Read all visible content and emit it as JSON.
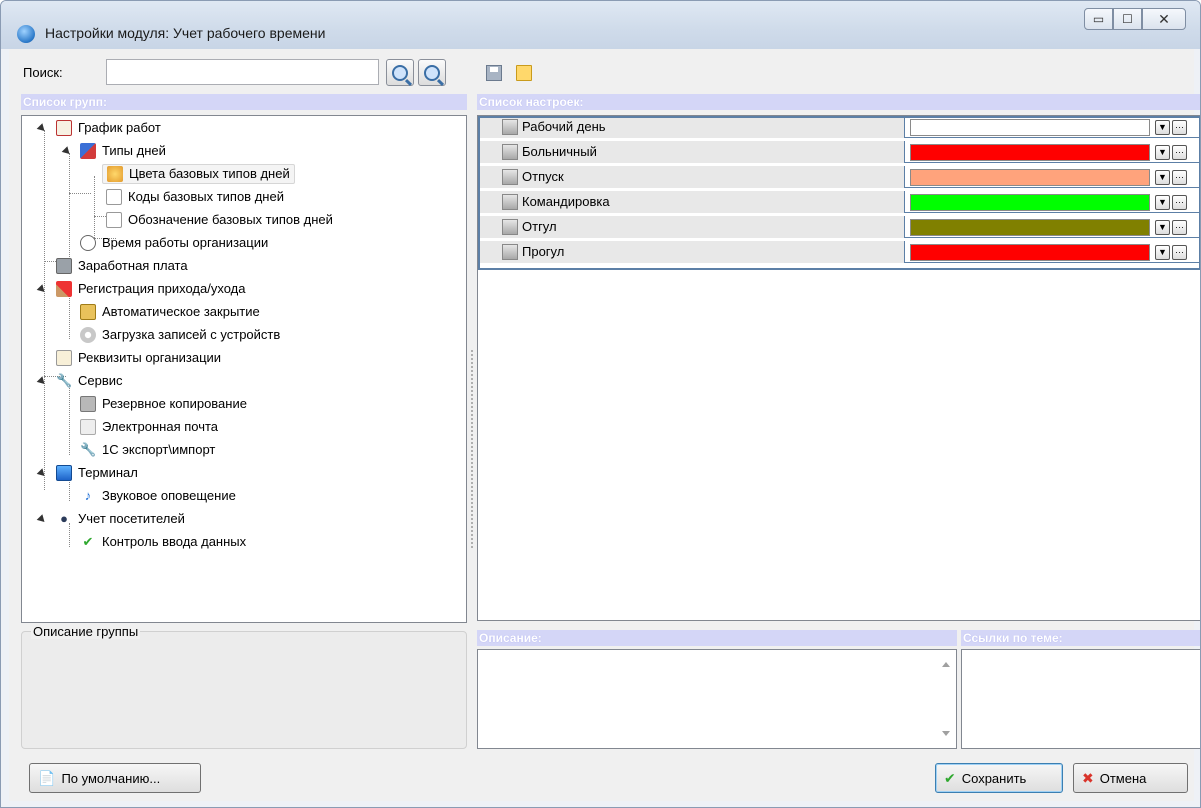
{
  "window": {
    "title": "Настройки модуля: Учет рабочего времени",
    "controls": {
      "minimize": "▭",
      "maximize": "☐",
      "close": "✕"
    }
  },
  "search": {
    "label": "Поиск:",
    "value": ""
  },
  "groups_header": "Список групп:",
  "settings_header": "Список настроек:",
  "tree": [
    {
      "label": "График работ",
      "icon": "calendar-icon"
    },
    {
      "label": "Типы дней",
      "icon": "blocks-icon"
    },
    {
      "label": "Цвета базовых типов дней",
      "icon": "palette-icon",
      "selected": true
    },
    {
      "label": "Коды базовых типов дней",
      "icon": "grid-icon"
    },
    {
      "label": "Обозначение базовых типов дней",
      "icon": "grid-icon"
    },
    {
      "label": "Время работы организации",
      "icon": "clock-icon"
    },
    {
      "label": "Заработная плата",
      "icon": "calculator-icon"
    },
    {
      "label": "Регистрация прихода/ухода",
      "icon": "hammer-icon"
    },
    {
      "label": "Автоматическое закрытие",
      "icon": "lock-icon"
    },
    {
      "label": "Загрузка записей с устройств",
      "icon": "disc-icon"
    },
    {
      "label": "Реквизиты организации",
      "icon": "document-icon"
    },
    {
      "label": "Сервис",
      "icon": "wrench-icon"
    },
    {
      "label": "Резервное копирование",
      "icon": "server-icon"
    },
    {
      "label": "Электронная почта",
      "icon": "envelope-icon"
    },
    {
      "label": "1С экспорт\\импорт",
      "icon": "wrench-icon"
    },
    {
      "label": "Терминал",
      "icon": "monitor-icon"
    },
    {
      "label": "Звуковое оповещение",
      "icon": "note-icon"
    },
    {
      "label": "Учет посетителей",
      "icon": "person-icon"
    },
    {
      "label": "Контроль ввода данных",
      "icon": "check-icon"
    }
  ],
  "settings": [
    {
      "label": "Рабочий день",
      "color": "#FFFFFF"
    },
    {
      "label": "Больничный",
      "color": "#FF0000"
    },
    {
      "label": "Отпуск",
      "color": "#FFA37C"
    },
    {
      "label": "Командировка",
      "color": "#00FF00"
    },
    {
      "label": "Отгул",
      "color": "#808000"
    },
    {
      "label": "Прогул",
      "color": "#FF0000"
    }
  ],
  "group_description_label": "Описание группы",
  "description_header": "Описание:",
  "links_header": "Ссылки по теме:",
  "buttons": {
    "defaults": "По умолчанию...",
    "save": "Сохранить",
    "cancel": "Отмена",
    "ellipsis": "···",
    "dropdown": "▼"
  }
}
